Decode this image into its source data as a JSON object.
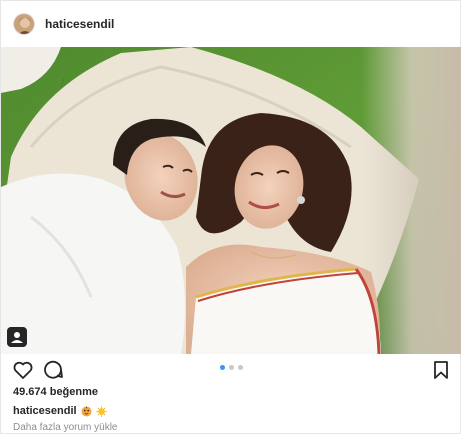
{
  "post": {
    "username": "haticesendil",
    "likes_count": "49.674",
    "likes_label": "beğenme",
    "caption_user": "haticesendil",
    "caption_emojis": [
      "tiger-face-emoji",
      "sun-face-emoji"
    ],
    "load_more": "Daha fazla yorum yükle",
    "carousel": {
      "count": 3,
      "active": 0
    },
    "icons": [
      "heart-icon",
      "comment-icon",
      "bookmark-icon",
      "user-tag-icon"
    ]
  },
  "colors": {
    "active_dot": "#3897f0",
    "inactive_dot": "#c7c7c7",
    "text": "#262626",
    "muted": "#8e8e8e"
  }
}
